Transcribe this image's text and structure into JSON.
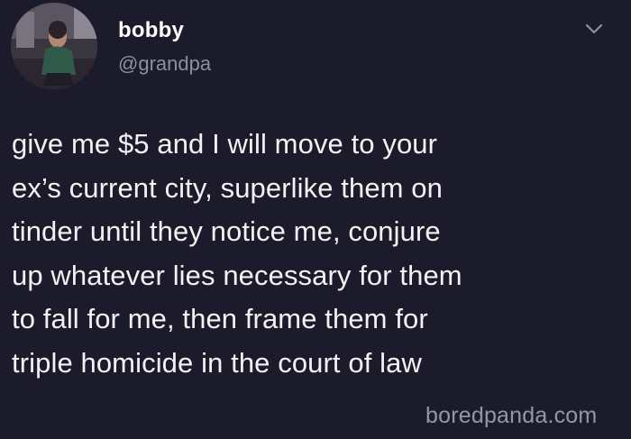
{
  "tweet": {
    "display_name": "bobby",
    "handle": "@grandpa",
    "text": "give me $5 and I will move to your\nex’s current city, superlike them on\ntinder until they notice me, conjure\nup whatever lies necessary for them\nto fall for me, then frame them for\ntriple homicide in the court of law",
    "menu_icon": "chevron-down-icon",
    "avatar_icon": "profile-photo"
  },
  "watermark": {
    "text": "boredpanda.com"
  },
  "colors": {
    "background": "#1c1b2c",
    "text": "#f2f2f2",
    "handle": "#8b90a0",
    "chevron": "#8b90a0"
  }
}
